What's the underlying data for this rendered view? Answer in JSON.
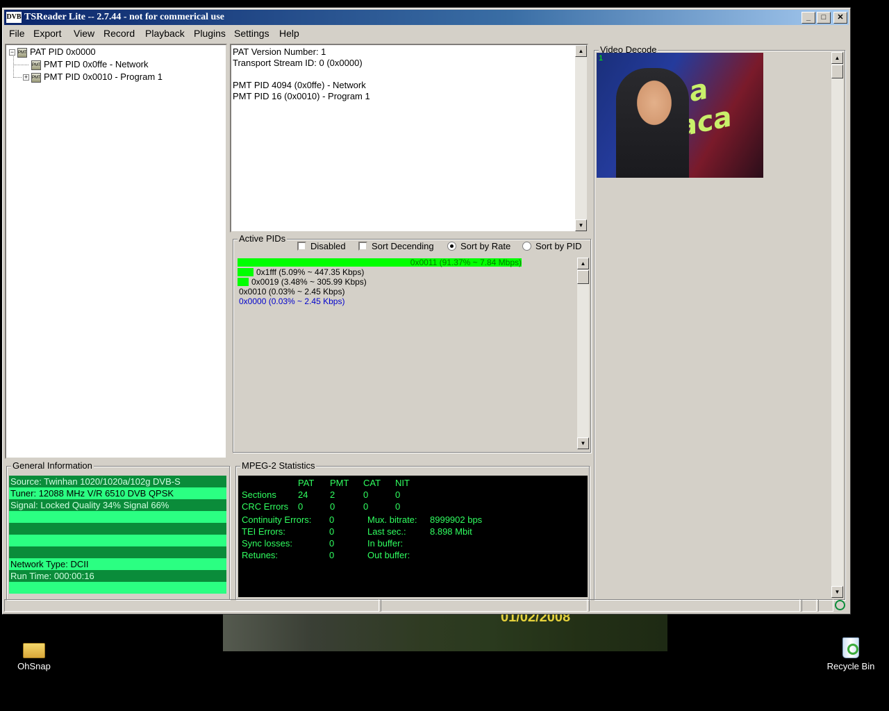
{
  "window": {
    "title": "TSReader Lite -- 2.7.44 - not for commerical use",
    "icon_label": "DVB",
    "controls": {
      "minimize": "_",
      "maximize": "□",
      "close": "✕"
    }
  },
  "menu": [
    "File",
    "Export",
    "View",
    "Record",
    "Playback",
    "Plugins",
    "Settings",
    "Help"
  ],
  "tree": {
    "root": {
      "label": "PAT PID 0x0000",
      "expander": "−"
    },
    "children": [
      {
        "label": "PMT PID 0x0ffe - Network"
      },
      {
        "label": "PMT PID 0x0010 - Program 1",
        "expander": "+"
      }
    ],
    "icon_text": "PMT"
  },
  "info": {
    "lines": [
      "PAT Version Number: 1",
      "Transport Stream ID: 0 (0x0000)",
      "",
      "PMT PID 4094 (0x0ffe) - Network",
      "PMT PID 16 (0x0010) - Program 1"
    ]
  },
  "active_pids": {
    "title": "Active PIDs",
    "options": {
      "disabled": "Disabled",
      "sort_descending": "Sort Decending",
      "sort_by_rate": "Sort by Rate",
      "sort_by_pid": "Sort by PID"
    },
    "selected_sort": "sort_by_rate",
    "rows": [
      {
        "label": "0x0011 (91.37% ~ 7.84 Mbps)",
        "percent": 91.37,
        "color": "#007a00"
      },
      {
        "label": "0x1fff (5.09% ~ 447.35 Kbps)",
        "percent": 5.09,
        "color": "#000000"
      },
      {
        "label": "0x0019 (3.48% ~ 305.99 Kbps)",
        "percent": 3.48,
        "color": "#000000"
      },
      {
        "label": "0x0010 (0.03% ~ 2.45 Kbps)",
        "percent": 0.03,
        "color": "#000000"
      },
      {
        "label": "0x0000 (0.03% ~ 2.45 Kbps)",
        "percent": 0.03,
        "color": "#0000cc"
      }
    ]
  },
  "video": {
    "title": "Video Decode",
    "frame_number": "1",
    "overlay_text": "La aca"
  },
  "general": {
    "title": "General Information",
    "rows": [
      "Source: Twinhan 1020/1020a/102g DVB-S",
      "Tuner: 12088 MHz V/R 6510 DVB QPSK",
      "Signal: Locked Quality 34% Signal 66%",
      "",
      "",
      "",
      "",
      "Network Type: DCII",
      "Run Time: 000:00:16",
      ""
    ]
  },
  "stats": {
    "title": "MPEG-2 Statistics",
    "columns": [
      "PAT",
      "PMT",
      "CAT",
      "NIT"
    ],
    "sections": {
      "label": "Sections",
      "values": [
        "24",
        "2",
        "0",
        "0"
      ]
    },
    "crc": {
      "label": "CRC Errors",
      "values": [
        "0",
        "0",
        "0",
        "0"
      ]
    },
    "counters": [
      {
        "label": "Continuity Errors:",
        "value": "0"
      },
      {
        "label": "TEI Errors:",
        "value": "0"
      },
      {
        "label": "Sync losses:",
        "value": "0"
      },
      {
        "label": "Retunes:",
        "value": "0"
      }
    ],
    "mux": [
      {
        "label": "Mux. bitrate:",
        "value": "8999902 bps"
      },
      {
        "label": "Last sec.:",
        "value": "8.898 Mbit"
      },
      {
        "label": "In buffer:",
        "value": ""
      },
      {
        "label": "Out buffer:",
        "value": ""
      }
    ]
  },
  "desktop": {
    "wallpaper_date": "01/02/2008",
    "icons": [
      {
        "label": "OhSnap"
      },
      {
        "label": "Recycle Bin"
      }
    ]
  }
}
